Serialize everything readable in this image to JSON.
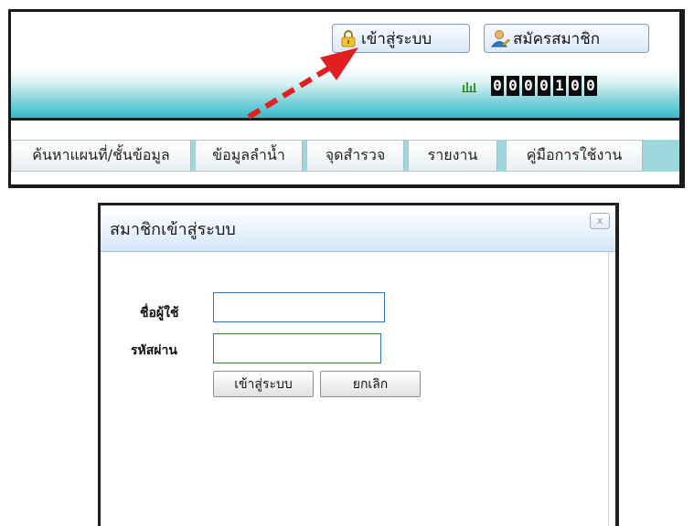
{
  "header": {
    "login_button": "เข้าสู่ระบบ",
    "register_button": "สมัครสมาชิก",
    "visitor_counter": [
      "0",
      "0",
      "0",
      "0",
      "1",
      "0",
      "0"
    ]
  },
  "tabs": [
    {
      "label": "ค้นหาแผนที่/ชั้นข้อมูล"
    },
    {
      "label": "ข้อมูลลำน้ำ"
    },
    {
      "label": "จุดสำรวจ"
    },
    {
      "label": "รายงาน"
    },
    {
      "label": "คู่มือการใช้งาน"
    }
  ],
  "login_dialog": {
    "title": "สมาชิกเข้าสู่ระบบ",
    "close_label": "x",
    "username_label": "ชื่อผู้ใช้",
    "username_value": "",
    "password_label": "รหัสผ่าน",
    "password_value": "",
    "submit_button": "เข้าสู่ระบบ",
    "cancel_button": "ยกเลิก"
  },
  "annotation": {
    "arrow_color": "#e02020"
  },
  "icons": {
    "login": "lock-icon",
    "register": "user-add-icon",
    "counter": "bar-chart-icon"
  }
}
